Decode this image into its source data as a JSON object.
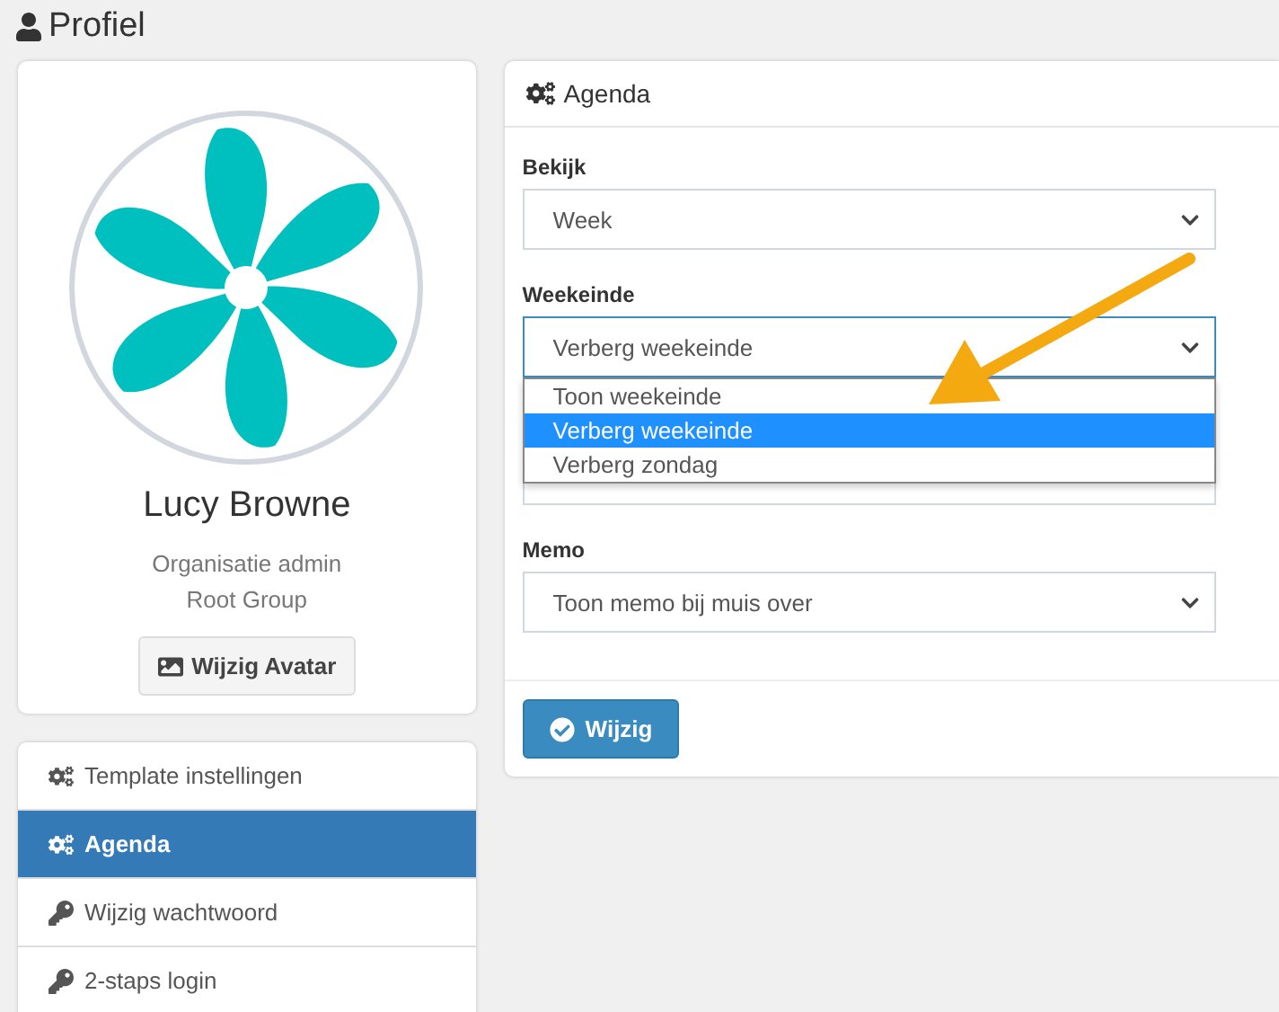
{
  "page_title": "Profiel",
  "profile": {
    "name": "Lucy Browne",
    "role": "Organisatie admin",
    "group": "Root Group",
    "avatar_button": "Wijzig Avatar"
  },
  "menu": [
    {
      "label": "Template instellingen",
      "kind": "gears",
      "selected": false
    },
    {
      "label": "Agenda",
      "kind": "gears",
      "selected": true
    },
    {
      "label": "Wijzig wachtwoord",
      "kind": "key",
      "selected": false
    },
    {
      "label": "2-staps login",
      "kind": "key",
      "selected": false
    }
  ],
  "panel": {
    "title": "Agenda",
    "fields": [
      {
        "kind": "select",
        "label": "Bekijk",
        "value": "Week",
        "focused": false
      },
      {
        "kind": "select",
        "label": "Weekeinde",
        "value": "Verberg weekeinde",
        "focused": true,
        "options": [
          {
            "label": "Toon weekeinde",
            "selected": false
          },
          {
            "label": "Verberg weekeinde",
            "selected": true
          },
          {
            "label": "Verberg zondag",
            "selected": false
          }
        ]
      },
      {
        "kind": "covered"
      },
      {
        "kind": "select",
        "label": "Memo",
        "value": "Toon memo bij muis over",
        "focused": false
      }
    ],
    "submit": "Wijzig"
  }
}
